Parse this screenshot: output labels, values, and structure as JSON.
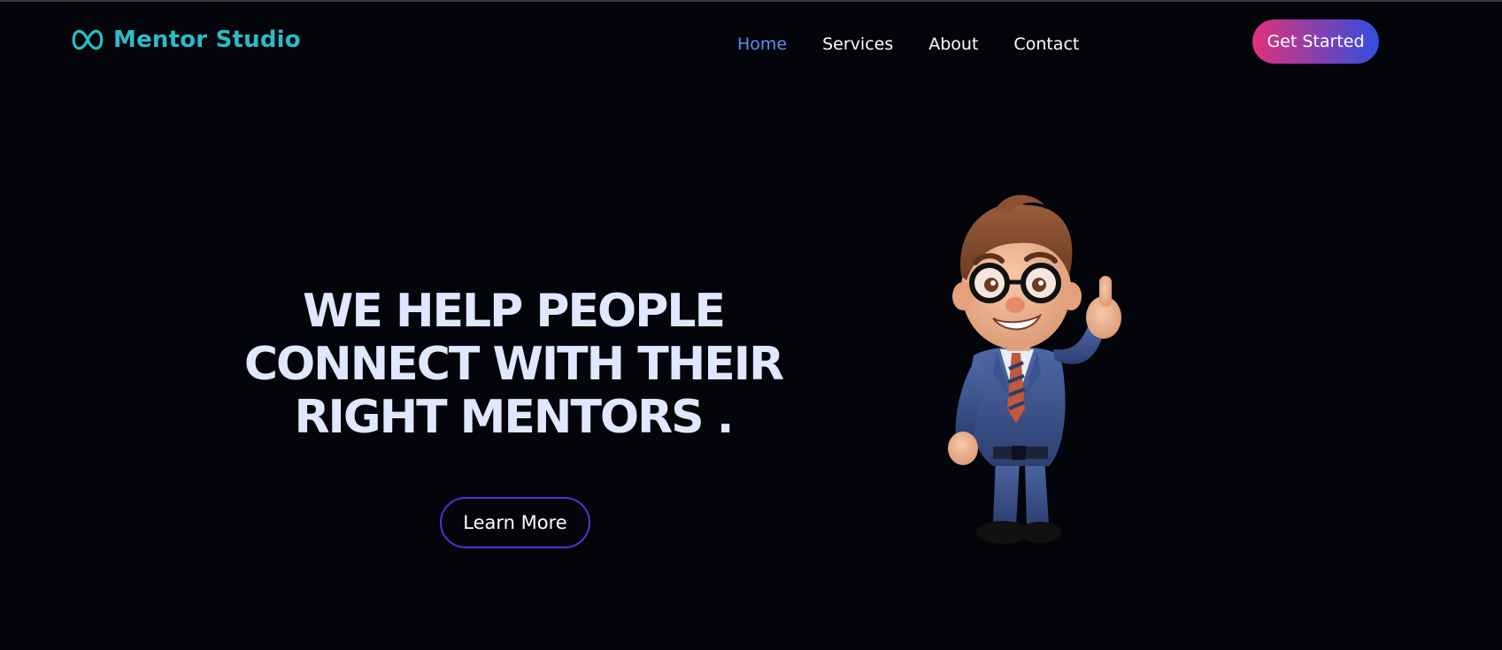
{
  "header": {
    "brand": "Mentor Studio",
    "brand_icon": "infinity-logo-icon",
    "brand_color": "#2cbcc7",
    "nav": [
      {
        "label": "Home",
        "active": true
      },
      {
        "label": "Services",
        "active": false
      },
      {
        "label": "About",
        "active": false
      },
      {
        "label": "Contact",
        "active": false
      }
    ],
    "active_color": "#5b8ef5",
    "cta_label": "Get Started",
    "cta_gradient": [
      "#e1317a",
      "#2f4fe0"
    ]
  },
  "hero": {
    "title_lines": [
      "WE HELP PEOPLE",
      "CONNECT WITH THEIR",
      "RIGHT MENTORS ."
    ],
    "learn_more_label": "Learn More",
    "title_color": "#dfe8ff",
    "button_border_color": "#5033d6",
    "illustration": "cartoon-mentor-thumbs-up"
  },
  "colors": {
    "background": "#04040b"
  }
}
